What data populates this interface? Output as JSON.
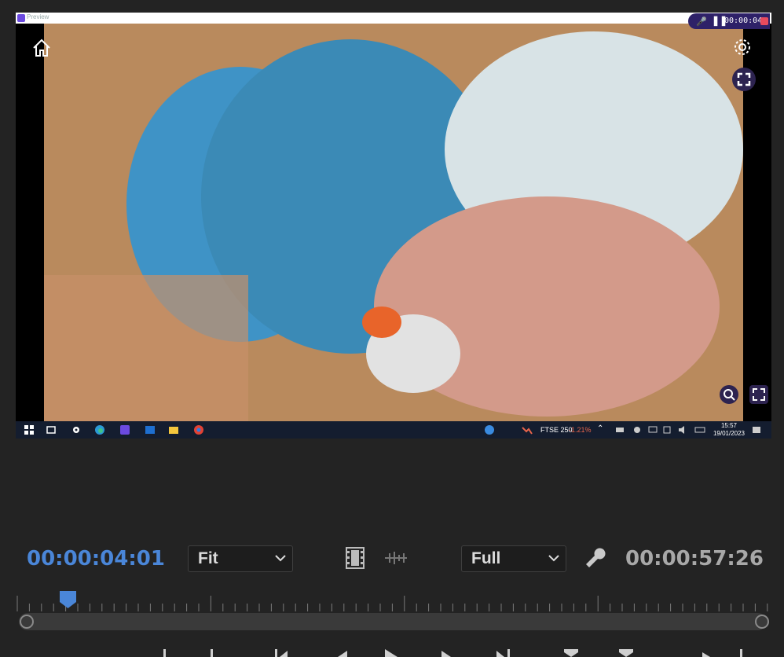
{
  "window": {
    "title": "Preview"
  },
  "recorder": {
    "time": "00:00:04"
  },
  "taskbar": {
    "ftse_label": "FTSE 250",
    "ftse_change": "-1.21%",
    "time": "15:57",
    "date": "19/01/2023"
  },
  "controls": {
    "current_timecode": "00:00:04:01",
    "zoom_select": "Fit",
    "resolution_select": "Full",
    "duration_timecode": "00:00:57:26"
  },
  "colors": {
    "accent": "#4a86d8",
    "record": "#e84b5d",
    "badge": "#2d2350"
  }
}
